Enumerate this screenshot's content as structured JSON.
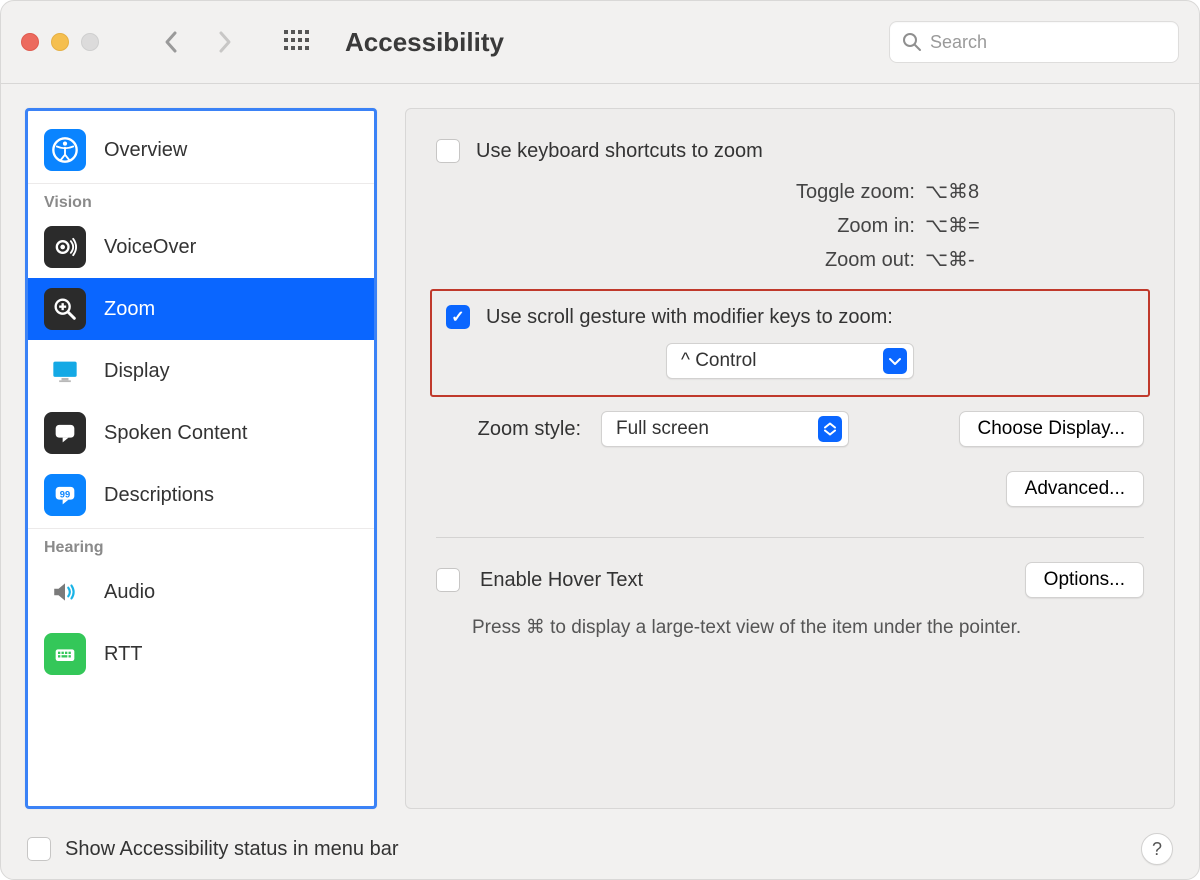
{
  "toolbar": {
    "title": "Accessibility",
    "search_placeholder": "Search"
  },
  "sidebar": {
    "overview_label": "Overview",
    "vision_heading": "Vision",
    "voiceover_label": "VoiceOver",
    "zoom_label": "Zoom",
    "display_label": "Display",
    "spoken_content_label": "Spoken Content",
    "descriptions_label": "Descriptions",
    "hearing_heading": "Hearing",
    "audio_label": "Audio",
    "rtt_label": "RTT"
  },
  "main": {
    "kb_shortcut_label": "Use keyboard shortcuts to zoom",
    "shortcuts": {
      "toggle_label": "Toggle zoom:",
      "toggle_value": "⌥⌘8",
      "zoomin_label": "Zoom in:",
      "zoomin_value": "⌥⌘=",
      "zoomout_label": "Zoom out:",
      "zoomout_value": "⌥⌘-"
    },
    "scroll_gesture_label": "Use scroll gesture with modifier keys to zoom:",
    "modifier_value": "^ Control",
    "zoom_style_label": "Zoom style:",
    "zoom_style_value": "Full screen",
    "choose_display_label": "Choose Display...",
    "advanced_label": "Advanced...",
    "hover_text_label": "Enable Hover Text",
    "hover_options_label": "Options...",
    "hover_desc": "Press ⌘ to display a large-text view of the item under the pointer."
  },
  "footer": {
    "status_label": "Show Accessibility status in menu bar",
    "help_label": "?"
  }
}
